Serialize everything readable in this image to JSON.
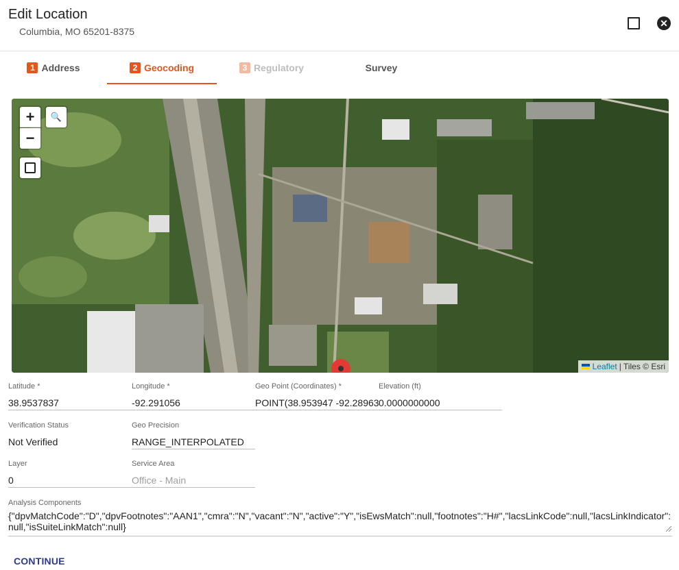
{
  "header": {
    "title": "Edit Location",
    "subtitle": "Columbia, MO 65201-8375"
  },
  "tabs": [
    {
      "num": "1",
      "label": "Address"
    },
    {
      "num": "2",
      "label": "Geocoding"
    },
    {
      "num": "3",
      "label": "Regulatory"
    },
    {
      "num": "",
      "label": "Survey"
    }
  ],
  "map": {
    "zoom_in": "+",
    "zoom_out": "−",
    "search_icon": "🔍",
    "attribution_link": "Leaflet",
    "attribution_text": "| Tiles © Esri"
  },
  "fields": {
    "latitude": {
      "label": "Latitude *",
      "value": "38.9537837"
    },
    "longitude": {
      "label": "Longitude *",
      "value": "-92.291056"
    },
    "geo_point": {
      "label": "Geo Point (Coordinates) *",
      "value": "POINT(38.953947 -92.289631"
    },
    "elevation": {
      "label": "Elevation (ft)",
      "value": "0.0000000000"
    },
    "verification_status": {
      "label": "Verification Status",
      "value": "Not Verified"
    },
    "geo_precision": {
      "label": "Geo Precision",
      "value": "RANGE_INTERPOLATED"
    },
    "layer": {
      "label": "Layer",
      "value": "0"
    },
    "service_area": {
      "label": "Service Area",
      "value": "Office - Main"
    },
    "analysis": {
      "label": "Analysis Components",
      "value": "{\"dpvMatchCode\":\"D\",\"dpvFootnotes\":\"AAN1\",\"cmra\":\"N\",\"vacant\":\"N\",\"active\":\"Y\",\"isEwsMatch\":null,\"footnotes\":\"H#\",\"lacsLinkCode\":null,\"lacsLinkIndicator\":null,\"isSuiteLinkMatch\":null}"
    }
  },
  "actions": {
    "continue_label": "CONTINUE"
  },
  "colors": {
    "accent": "#e8541c",
    "continue": "#2b3a8f"
  }
}
